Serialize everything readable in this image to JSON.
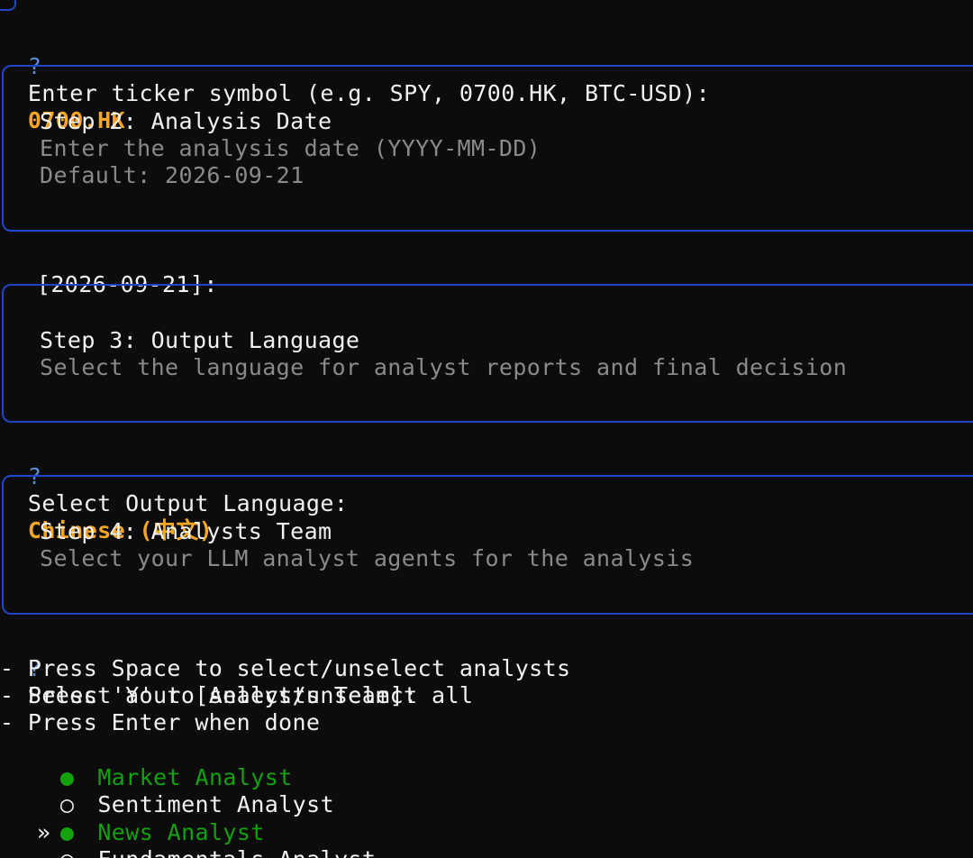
{
  "ticker": {
    "prompt_mark": "?",
    "prompt": "Enter ticker symbol (e.g. SPY, 0700.HK, BTC-USD):",
    "answer": "0700.HK"
  },
  "step2": {
    "title": "Step 2: Analysis Date",
    "subtitle": "Enter the analysis date (YYYY-MM-DD)",
    "default": "Default: 2026-09-21"
  },
  "date_input": {
    "prompt": "[2026-09-21]:"
  },
  "step3": {
    "title": "Step 3: Output Language",
    "subtitle": "Select the language for analyst reports and final decision"
  },
  "language": {
    "prompt_mark": "?",
    "prompt": "Select Output Language:",
    "answer": "Chinese (中文)"
  },
  "step4": {
    "title": "Step 4: Analysts Team",
    "subtitle": "Select your LLM analyst agents for the analysis"
  },
  "analysts": {
    "prompt_mark": "?",
    "prompt": "Select Your [Analysts Team]:",
    "instructions": [
      "- Press Space to select/unselect analysts",
      "- Press 'a' to select/unselect all",
      "- Press Enter when done"
    ],
    "options": [
      {
        "label": "Market Analyst",
        "selected": true,
        "cursor": false,
        "marker": "●",
        "pointer": ""
      },
      {
        "label": "Sentiment Analyst",
        "selected": false,
        "cursor": false,
        "marker": "○",
        "pointer": ""
      },
      {
        "label": "News Analyst",
        "selected": true,
        "cursor": true,
        "marker": "●",
        "pointer": "»"
      },
      {
        "label": "Fundamentals Analyst",
        "selected": false,
        "cursor": false,
        "marker": "○",
        "pointer": ""
      }
    ]
  },
  "colors": {
    "background": "#0c0c0c",
    "panel_border": "#1f45c9",
    "answer": "#f5a623",
    "selected": "#13a10e",
    "muted": "#8a8a8a"
  }
}
